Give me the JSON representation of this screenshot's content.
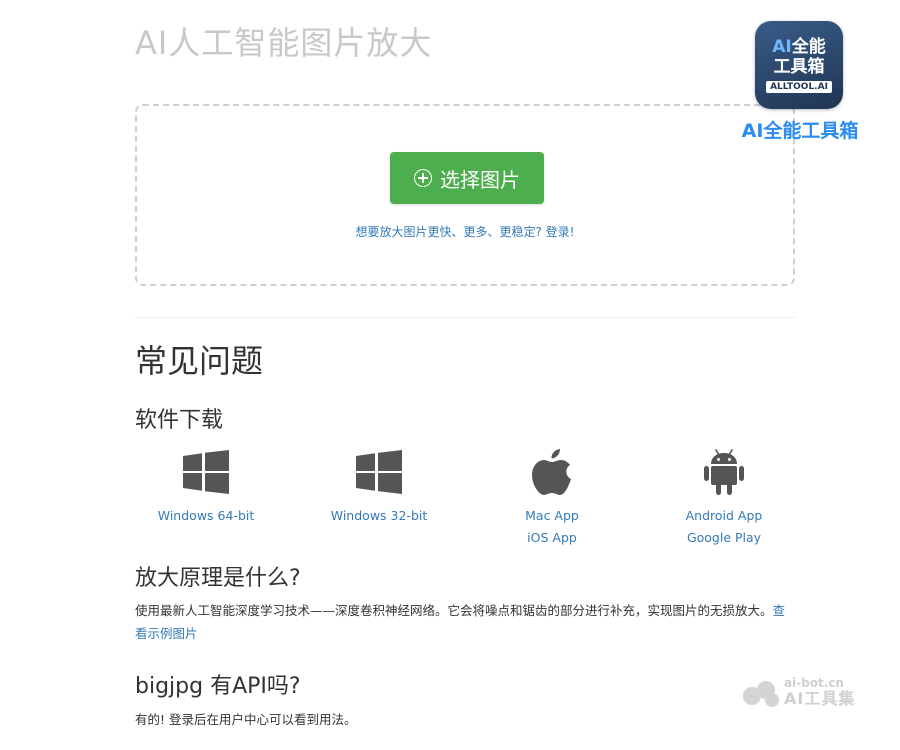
{
  "header": {
    "title": "AI人工智能图片放大"
  },
  "upload": {
    "button_label": "选择图片",
    "login_hint": "想要放大图片更快、更多、更稳定? 登录!"
  },
  "faq": {
    "title": "常见问题",
    "software": {
      "heading": "软件下载",
      "downloads": [
        {
          "icon": "windows-icon",
          "links": [
            "Windows 64-bit"
          ]
        },
        {
          "icon": "windows-icon",
          "links": [
            "Windows 32-bit"
          ]
        },
        {
          "icon": "apple-icon",
          "links": [
            "Mac App",
            "iOS App"
          ]
        },
        {
          "icon": "android-icon",
          "links": [
            "Android App",
            "Google Play"
          ]
        }
      ]
    },
    "principle": {
      "heading": "放大原理是什么?",
      "text": "使用最新人工智能深度学习技术——深度卷积神经网络。它会将噪点和锯齿的部分进行补充，实现图片的无损放大。",
      "link": "查看示例图片"
    },
    "api": {
      "heading": "bigjpg 有API吗?",
      "text": "有的! 登录后在用户中心可以看到用法。"
    }
  },
  "logo": {
    "line1_ai": "AI",
    "line1_rest": "全能",
    "line2": "工具箱",
    "line3": "ALLTOOL.AI",
    "caption": "AI全能工具箱"
  },
  "watermark": {
    "line1": "ai-bot.cn",
    "line2": "AI工具集"
  },
  "colors": {
    "accent_green": "#4cae4c",
    "link_blue": "#337ab7",
    "caption_blue": "#2d8cf0"
  }
}
